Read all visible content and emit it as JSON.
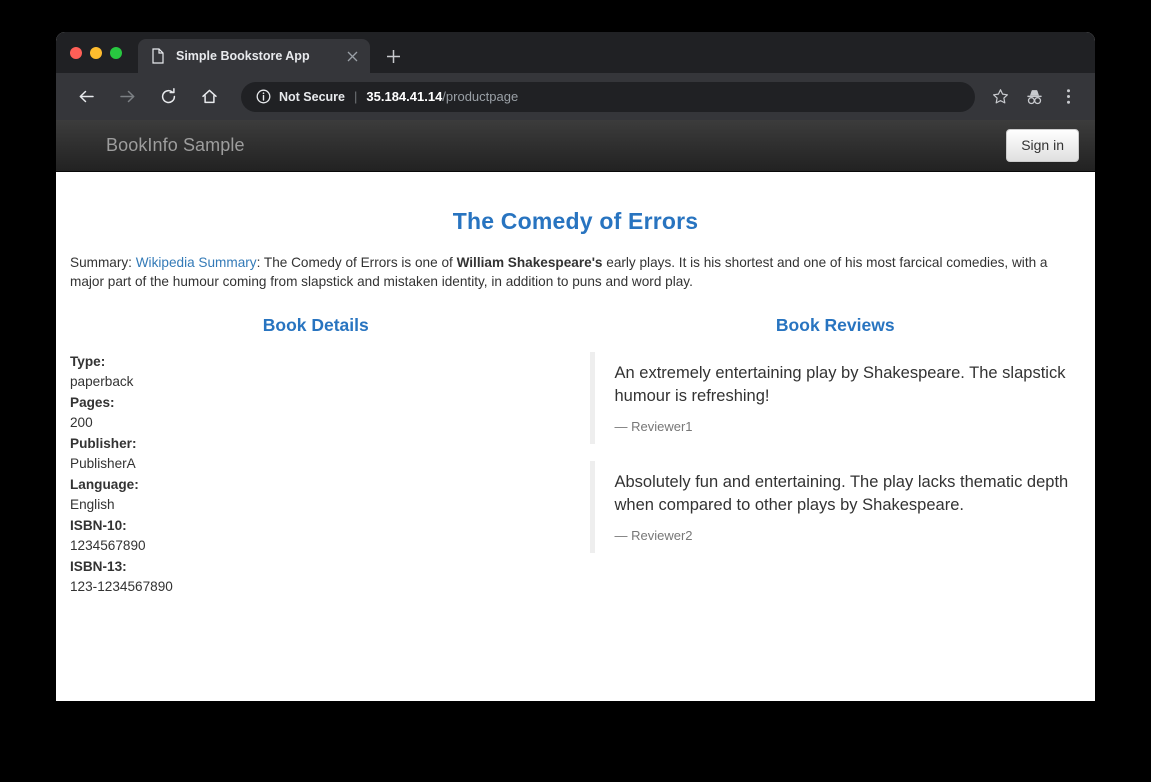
{
  "browser": {
    "tab": {
      "title": "Simple Bookstore App",
      "favicon_icon": "page-icon",
      "close_icon": "close-icon"
    },
    "new_tab_icon": "plus-icon",
    "toolbar": {
      "back_icon": "back-arrow-icon",
      "forward_icon": "forward-arrow-icon",
      "reload_icon": "reload-icon",
      "home_icon": "home-icon",
      "security_icon": "info-circle-icon",
      "security_label": "Not Secure",
      "url_separator": "|",
      "url_host": "35.184.41.14",
      "url_path": "/productpage",
      "bookmark_icon": "star-icon",
      "incognito_icon": "incognito-icon",
      "menu_icon": "three-dot-menu-icon"
    }
  },
  "page": {
    "navbar": {
      "brand": "BookInfo Sample",
      "signin_label": "Sign in"
    },
    "product_title": "The Comedy of Errors",
    "summary": {
      "prefix": "Summary: ",
      "link_text": "Wikipedia Summary",
      "part1": ": The Comedy of Errors is one of ",
      "bold": "William Shakespeare's",
      "part2": " early plays. It is his shortest and one of his most farcical comedies, with a major part of the humour coming from slapstick and mistaken identity, in addition to puns and word play."
    },
    "details": {
      "heading": "Book Details",
      "items": [
        {
          "label": "Type:",
          "value": "paperback"
        },
        {
          "label": "Pages:",
          "value": "200"
        },
        {
          "label": "Publisher:",
          "value": "PublisherA"
        },
        {
          "label": "Language:",
          "value": "English"
        },
        {
          "label": "ISBN-10:",
          "value": "1234567890"
        },
        {
          "label": "ISBN-13:",
          "value": "123-1234567890"
        }
      ]
    },
    "reviews": {
      "heading": "Book Reviews",
      "items": [
        {
          "text": "An extremely entertaining play by Shakespeare. The slapstick humour is refreshing!",
          "author": "Reviewer1"
        },
        {
          "text": "Absolutely fun and entertaining. The play lacks thematic depth when compared to other plays by Shakespeare.",
          "author": "Reviewer2"
        }
      ]
    }
  },
  "colors": {
    "accent_blue": "#2874c0",
    "link_blue": "#337ab7",
    "navbar_dark": "#222222",
    "page_bg": "#ffffff"
  }
}
